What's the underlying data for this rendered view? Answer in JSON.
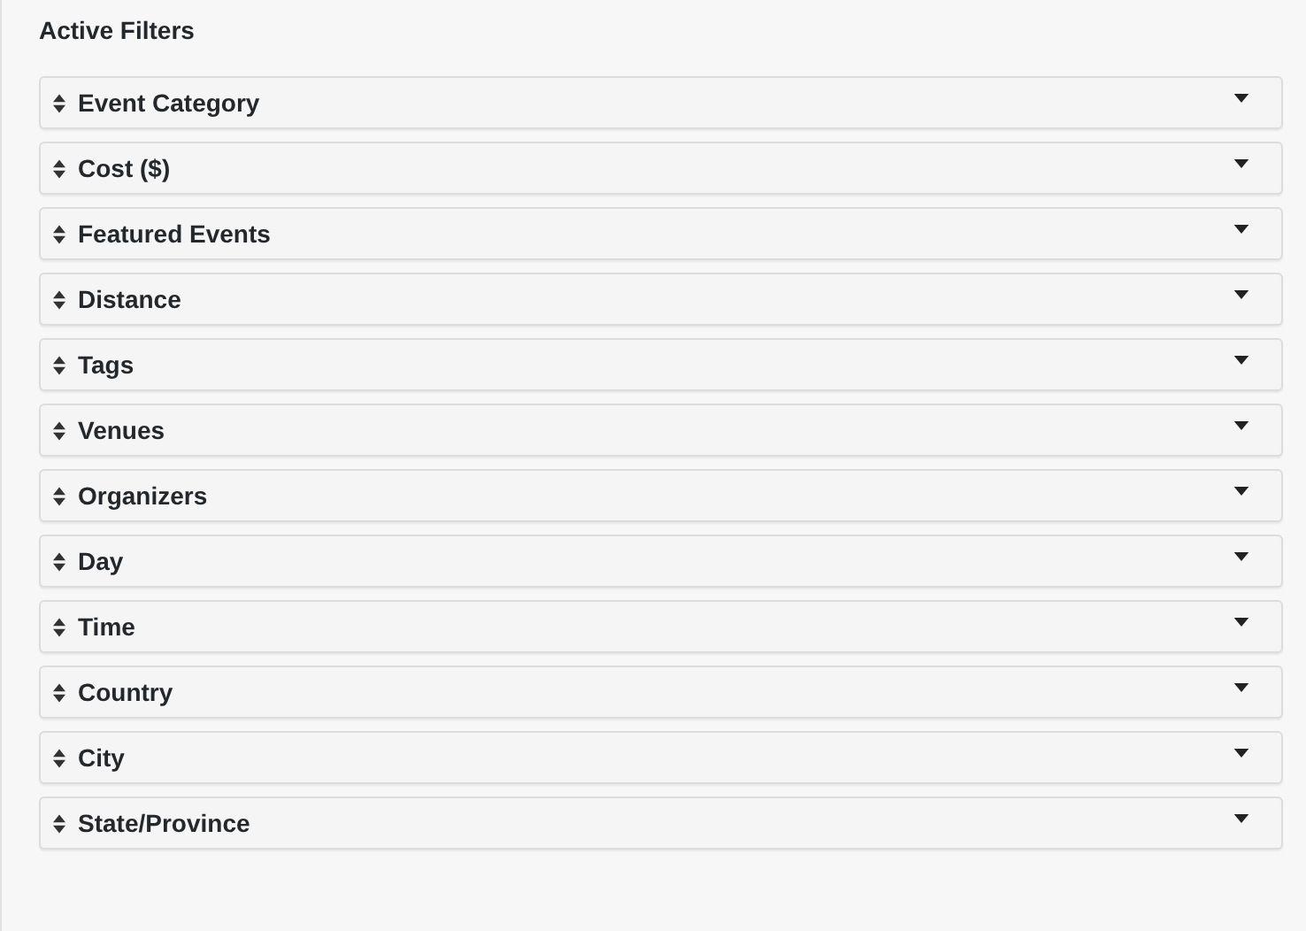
{
  "title": "Active Filters",
  "filters": [
    {
      "label": "Event Category"
    },
    {
      "label": "Cost ($)"
    },
    {
      "label": "Featured Events"
    },
    {
      "label": "Distance"
    },
    {
      "label": "Tags"
    },
    {
      "label": "Venues"
    },
    {
      "label": "Organizers"
    },
    {
      "label": "Day"
    },
    {
      "label": "Time"
    },
    {
      "label": "Country"
    },
    {
      "label": "City"
    },
    {
      "label": "State/Province"
    }
  ]
}
